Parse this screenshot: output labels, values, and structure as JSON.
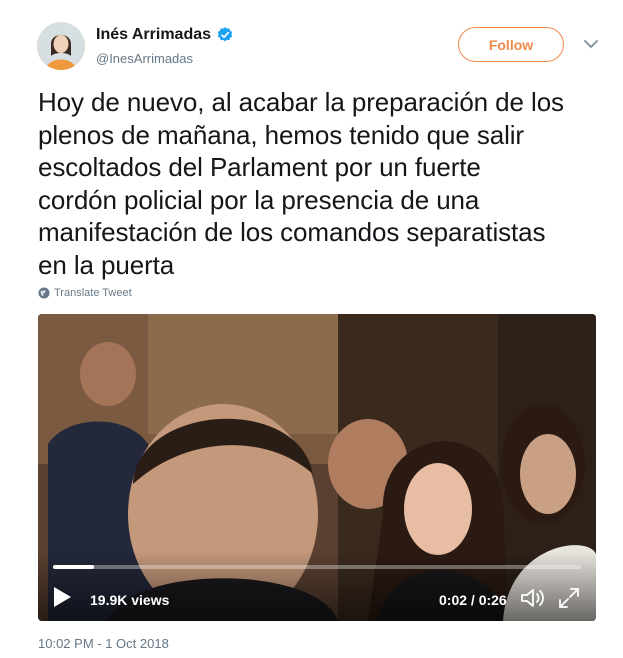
{
  "author": {
    "name": "Inés Arrimadas",
    "handle": "@InesArrimadas",
    "verified_icon": "verified-badge-icon",
    "avatar_icon": "avatar"
  },
  "follow_button": {
    "label": "Follow"
  },
  "menu": {
    "icon": "chevron-down-icon"
  },
  "tweet": {
    "lines": [
      "Hoy de nuevo, al acabar la preparación de los",
      "plenos de mañana, hemos tenido que salir",
      "escoltados del Parlament por un fuerte",
      "cordón policial por la presencia de una",
      "manifestación de los comandos separatistas",
      "en la puerta"
    ]
  },
  "translate": {
    "label": "Translate Tweet",
    "icon": "globe-icon"
  },
  "video": {
    "views": "19.9K views",
    "time": "0:02 / 0:26",
    "progress": 0.077,
    "icons": [
      "play-icon",
      "volume-icon",
      "fullscreen-icon"
    ]
  },
  "timestamp": "10:02 PM - 1 Oct 2018",
  "colors": {
    "accent": "#f08a4b",
    "verified": "#1da1f2",
    "secondary_text": "#657786",
    "primary_text": "#14171a"
  }
}
